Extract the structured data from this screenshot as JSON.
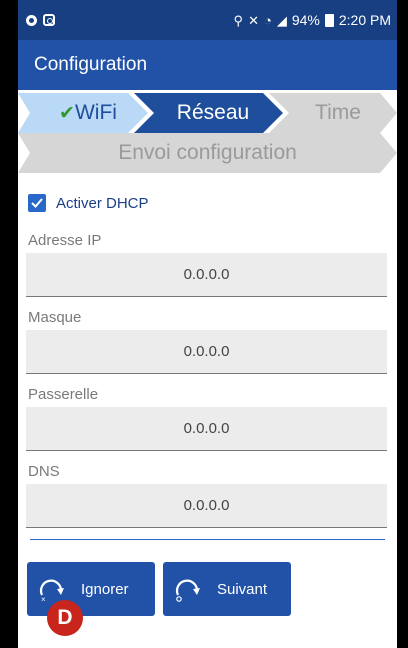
{
  "status_bar": {
    "battery": "94%",
    "time": "2:20 PM"
  },
  "app_bar": {
    "title": "Configuration"
  },
  "steps": {
    "wifi": {
      "label": "WiFi",
      "check": "✔"
    },
    "reseau": {
      "label": "Réseau"
    },
    "time": {
      "label": "Time"
    },
    "envoi": {
      "label": "Envoi configuration"
    }
  },
  "form": {
    "dhcp_label": "Activer DHCP",
    "dhcp_checked": true,
    "ip_label": "Adresse IP",
    "ip_value": "0.0.0.0",
    "mask_label": "Masque",
    "mask_value": "0.0.0.0",
    "gateway_label": "Passerelle",
    "gateway_value": "0.0.0.0",
    "dns_label": "DNS",
    "dns_value": "0.0.0.0"
  },
  "buttons": {
    "ignorer": "Ignorer",
    "suivant": "Suivant"
  },
  "badge": "D",
  "colors": {
    "status_bar": "#173f82",
    "app_bar": "#2152a8",
    "step_done": "#b9d9f7",
    "step_current": "#1f4f9c",
    "step_pending": "#d6d6d6",
    "check_green": "#2e9a2e",
    "badge_red": "#c8261c"
  }
}
